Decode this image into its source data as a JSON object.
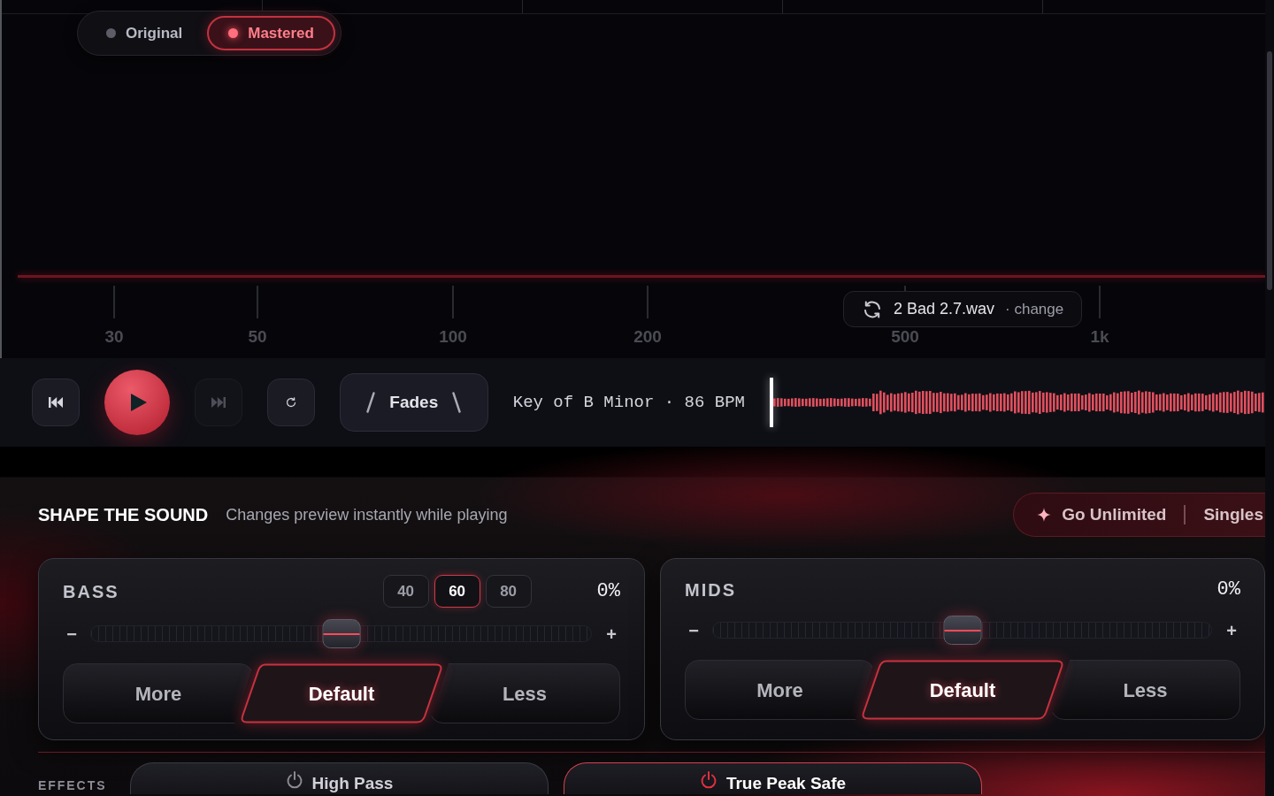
{
  "view_toggle": [
    {
      "label": "Original",
      "selected": false
    },
    {
      "label": "Mastered",
      "selected": true
    }
  ],
  "frequency_axis": [
    "30",
    "50",
    "100",
    "200",
    "500",
    "1k"
  ],
  "file": {
    "name": "2 Bad 2.7.wav",
    "action": "· change"
  },
  "player": {
    "buttons": [
      {
        "kind": "previous",
        "disabled": false
      },
      {
        "kind": "play",
        "disabled": false
      },
      {
        "kind": "next",
        "disabled": true
      },
      {
        "kind": "repeat",
        "disabled": false
      }
    ],
    "fades": "Fades",
    "track_info": "Key of B Minor · 86 BPM"
  },
  "shape": {
    "title": "SHAPE THE SOUND",
    "subtitle": "Changes preview instantly while playing",
    "upgrade": {
      "primary": "Go Unlimited",
      "secondary": "Singles"
    }
  },
  "bands": [
    {
      "name": "BASS",
      "presets": [
        {
          "label": "40",
          "selected": false
        },
        {
          "label": "60",
          "selected": true
        },
        {
          "label": "80",
          "selected": false
        }
      ],
      "value": "0%",
      "minus": "−",
      "plus": "+",
      "level": 0.5,
      "options": [
        {
          "label": "More",
          "selected": false
        },
        {
          "label": "Default",
          "selected": true
        },
        {
          "label": "Less",
          "selected": false
        }
      ]
    },
    {
      "name": "MIDS",
      "value": "0%",
      "minus": "−",
      "plus": "+",
      "level": 0.5,
      "options": [
        {
          "label": "More",
          "selected": false
        },
        {
          "label": "Default",
          "selected": true
        },
        {
          "label": "Less",
          "selected": false
        }
      ]
    }
  ],
  "effects": {
    "label": "EFFECTS",
    "items": [
      {
        "label": "High Pass",
        "on": false
      },
      {
        "label": "True Peak Safe",
        "on": true
      }
    ]
  }
}
